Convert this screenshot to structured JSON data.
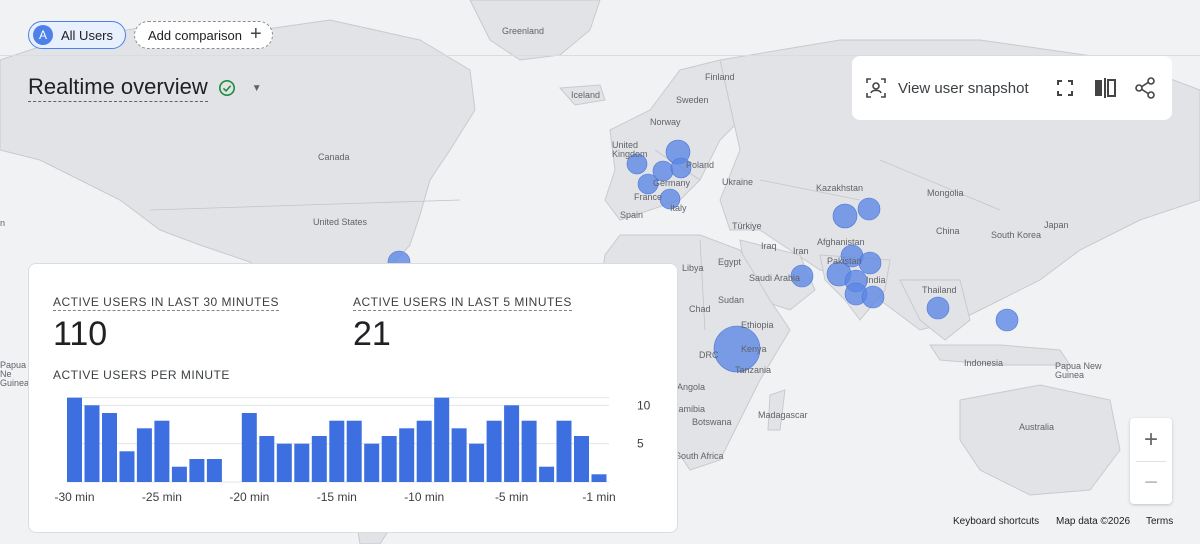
{
  "segment_chip": {
    "avatar": "A",
    "label": "All Users"
  },
  "add_comparison": {
    "label": "Add comparison",
    "icon": "plus-icon"
  },
  "header": {
    "title": "Realtime overview",
    "status_icon": "check-circle-icon",
    "status_color": "#1e8e3e"
  },
  "toolbar": {
    "snapshot_label": "View user snapshot",
    "icons": [
      "user-snapshot-icon",
      "fullscreen-icon",
      "compare-icon",
      "share-icon"
    ]
  },
  "stats": {
    "users_30_label": "ACTIVE USERS IN LAST 30 MINUTES",
    "users_30_value": "110",
    "users_5_label": "ACTIVE USERS IN LAST 5 MINUTES",
    "users_5_value": "21",
    "per_minute_label": "ACTIVE USERS PER MINUTE"
  },
  "chart_data": {
    "type": "bar",
    "title": "ACTIVE USERS PER MINUTE",
    "categories": [
      "-30 min",
      "-29 min",
      "-28 min",
      "-27 min",
      "-26 min",
      "-25 min",
      "-24 min",
      "-23 min",
      "-22 min",
      "-21 min",
      "-20 min",
      "-19 min",
      "-18 min",
      "-17 min",
      "-16 min",
      "-15 min",
      "-14 min",
      "-13 min",
      "-12 min",
      "-11 min",
      "-10 min",
      "-9 min",
      "-8 min",
      "-7 min",
      "-6 min",
      "-5 min",
      "-4 min",
      "-3 min",
      "-2 min",
      "-1 min"
    ],
    "values": [
      11,
      10,
      9,
      4,
      7,
      8,
      2,
      3,
      3,
      0,
      9,
      6,
      5,
      5,
      6,
      8,
      8,
      5,
      6,
      7,
      8,
      11,
      7,
      5,
      8,
      10,
      8,
      2,
      8,
      6,
      1
    ],
    "x_tick_labels": [
      "-30 min",
      "-25 min",
      "-20 min",
      "-15 min",
      "-10 min",
      "-5 min",
      "-1 min"
    ],
    "y_tick_labels": [
      "5",
      "10"
    ],
    "ylim": [
      0,
      12
    ],
    "color": "#3d6fe0",
    "grid": true
  },
  "map": {
    "labels": [
      "Greenland",
      "Finland",
      "Iceland",
      "Sweden",
      "Norway",
      "United Kingdom",
      "Poland",
      "Germany",
      "France",
      "Italy",
      "Spain",
      "Ukraine",
      "Kazakhstan",
      "Mongolia",
      "China",
      "Japan",
      "South Korea",
      "Canada",
      "United States",
      "Türkiye",
      "Iraq",
      "Iran",
      "Afghanistan",
      "Pakistan",
      "India",
      "Thailand",
      "Libya",
      "Egypt",
      "Saudi Arabia",
      "Sudan",
      "Chad",
      "Ethiopia",
      "Kenya",
      "DRC",
      "Tanzania",
      "Angola",
      "Namibia",
      "Botswana",
      "Madagascar",
      "South Africa",
      "Indonesia",
      "Papua New Guinea",
      "Australia",
      "n",
      "Papua Ne Guinea"
    ],
    "bubble_color": "#5b86e5"
  },
  "zoom": {
    "in": "+",
    "out": "−"
  },
  "attribution": {
    "shortcuts": "Keyboard shortcuts",
    "map_data": "Map data ©2026",
    "terms": "Terms"
  }
}
